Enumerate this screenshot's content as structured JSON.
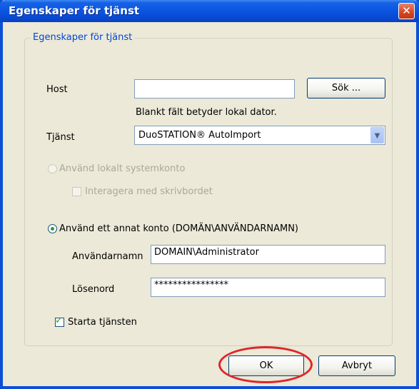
{
  "window": {
    "title": "Egenskaper för tjänst",
    "close_label": "✕"
  },
  "group": {
    "title": "Egenskaper för tjänst"
  },
  "host": {
    "label": "Host",
    "value": "",
    "search_button": "Sök ...",
    "hint": "Blankt fält betyder lokal dator."
  },
  "service": {
    "label": "Tjänst",
    "selected": "DuoSTATION® AutoImport"
  },
  "local_account": {
    "label": "Använd lokalt systemkonto",
    "selected": false,
    "enabled": false,
    "interact_desktop": {
      "label": "Interagera med skrivbordet",
      "checked": false,
      "enabled": false
    }
  },
  "other_account": {
    "label": "Använd ett annat konto (DOMÄN\\ANVÄNDARNAMN)",
    "selected": true,
    "username_label": "Användarnamn",
    "username_value": "DOMAIN\\Administrator",
    "password_label": "Lösenord",
    "password_value": "****************"
  },
  "start_service": {
    "label": "Starta tjänsten",
    "checked": true
  },
  "buttons": {
    "ok": "OK",
    "cancel": "Avbryt"
  },
  "colors": {
    "titlebar": "#0a55e0",
    "group_title": "#0046d5",
    "highlight": "#e0262a",
    "check": "#21a121"
  }
}
